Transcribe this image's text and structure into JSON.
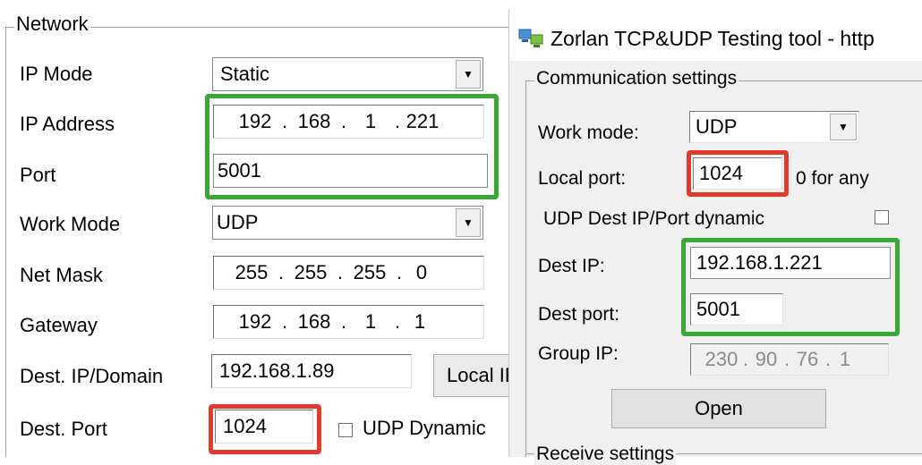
{
  "left": {
    "group_title": "Network",
    "ip_mode": {
      "label": "IP Mode",
      "value": "Static"
    },
    "ip_address": {
      "label": "IP Address",
      "octets": [
        "192",
        "168",
        "1",
        "221"
      ]
    },
    "port": {
      "label": "Port",
      "value": "5001"
    },
    "work_mode": {
      "label": "Work Mode",
      "value": "UDP"
    },
    "net_mask": {
      "label": "Net Mask",
      "octets": [
        "255",
        "255",
        "255",
        "0"
      ]
    },
    "gateway": {
      "label": "Gateway",
      "octets": [
        "192",
        "168",
        "1",
        "1"
      ]
    },
    "dest_ip": {
      "label": "Dest. IP/Domain",
      "value": "192.168.1.89"
    },
    "local_ip_button": "Local IP",
    "dest_port": {
      "label": "Dest. Port",
      "value": "1024"
    },
    "udp_dynamic": {
      "label": "UDP Dynamic",
      "checked": false
    }
  },
  "right": {
    "window_title": "Zorlan TCP&UDP Testing tool - http",
    "group_title": "Communication settings",
    "work_mode": {
      "label": "Work mode:",
      "value": "UDP"
    },
    "local_port": {
      "label": "Local port:",
      "value": "1024",
      "hint": "0 for any"
    },
    "udp_dest_dynamic": {
      "label": "UDP Dest IP/Port dynamic",
      "checked": false
    },
    "dest_ip": {
      "label": "Dest IP:",
      "value": "192.168.1.221"
    },
    "dest_port": {
      "label": "Dest port:",
      "value": "5001"
    },
    "group_ip": {
      "label": "Group IP:",
      "octets": [
        "230",
        "90",
        "76",
        "1"
      ]
    },
    "open_button": "Open",
    "next_group_title": "Receive settings"
  },
  "colors": {
    "highlight_green": "#3aa835",
    "highlight_red": "#e03a2e"
  }
}
